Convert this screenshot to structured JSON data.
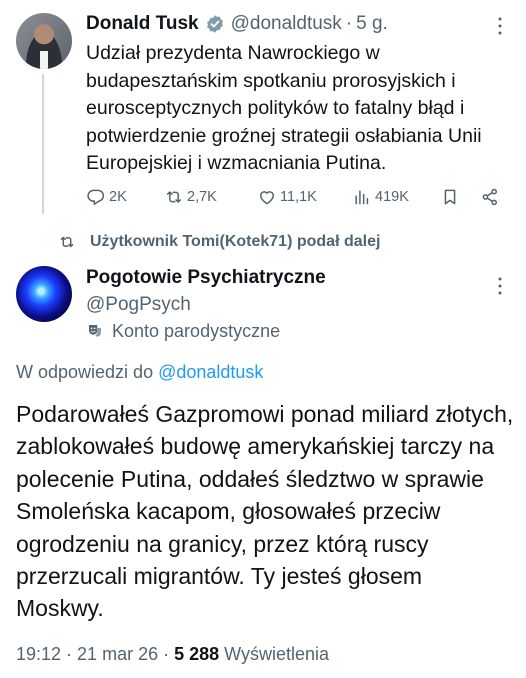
{
  "tweet1": {
    "author_name": "Donald Tusk",
    "handle": "@donaldtusk",
    "separator": "·",
    "time": "5 g.",
    "text": "Udział prezydenta Nawrockiego w budapesztańskim spotkaniu prorosyjskich i eurosceptycznych polityków to fatalny błąd i potwierdzenie groźnej strategii osłabiania Unii Europejskiej i wzmacniania Putina.",
    "actions": {
      "replies": "2K",
      "reposts": "2,7K",
      "likes": "11,1K",
      "views": "419K"
    }
  },
  "repost_banner": {
    "text": "Użytkownik Tomi(Kotek71) podał dalej"
  },
  "tweet2": {
    "author_name": "Pogotowie Psychiatryczne",
    "handle": "@PogPsych",
    "parody_label": "Konto parodystyczne",
    "reply_prefix": "W odpowiedzi do ",
    "reply_handle": "@donaldtusk",
    "text": "Podarowałeś Gazpromowi ponad miliard złotych, zablokowałeś budowę amerykańskiej tarczy na polecenie Putina, oddałeś śledztwo w sprawie Smoleńska kacapom, głosowałeś przeciw ogrodzeniu na granicy, przez którą ruscy przerzucali migrantów. Ty jesteś głosem Moskwy.",
    "time": "19:12",
    "sep1": " · ",
    "date": "21 mar 26",
    "sep2": " · ",
    "views_count": "5 288",
    "views_label": " Wyświetlenia"
  },
  "colors": {
    "accent": "#1d9bf0",
    "secondary_text": "#536471",
    "primary_text": "#0f1419",
    "verified_badge": "#829aab"
  }
}
